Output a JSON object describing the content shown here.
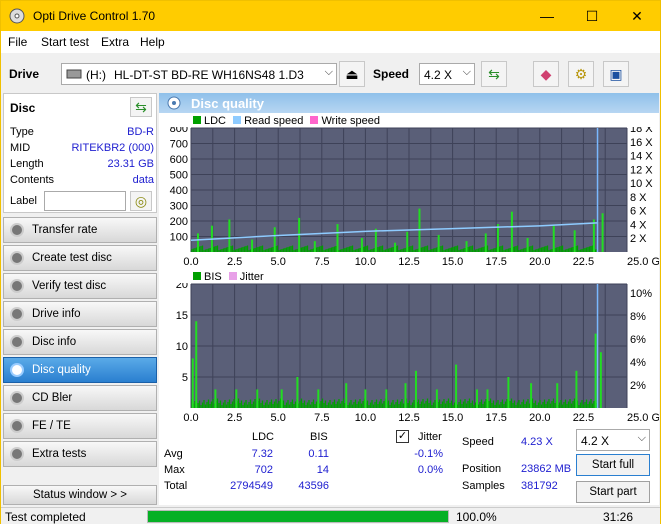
{
  "window": {
    "title": "Opti Drive Control 1.70",
    "min": "—",
    "max": "☐",
    "close": "✕"
  },
  "menu": [
    "File",
    "Start test",
    "Extra",
    "Help"
  ],
  "drivebar": {
    "drive_label": "Drive",
    "drive_letter": "(H:)",
    "drive_name": "HL-DT-ST BD-RE  WH16NS48 1.D3",
    "speed_label": "Speed",
    "speed_value": "4.2 X"
  },
  "disc": {
    "header": "Disc",
    "rows": [
      {
        "k": "Type",
        "v": "BD-R"
      },
      {
        "k": "MID",
        "v": "RITEKBR2 (000)"
      },
      {
        "k": "Length",
        "v": "23.31 GB"
      },
      {
        "k": "Contents",
        "v": "data"
      }
    ],
    "label_key": "Label",
    "label_value": ""
  },
  "nav": [
    "Transfer rate",
    "Create test disc",
    "Verify test disc",
    "Drive info",
    "Disc info",
    "Disc quality",
    "CD Bler",
    "FE / TE",
    "Extra tests"
  ],
  "nav_selected": 5,
  "status_window_btn": "Status window > >",
  "panel_title": "Disc quality",
  "legend_top": {
    "ldc": "LDC",
    "read": "Read speed",
    "write": "Write speed"
  },
  "legend_bottom": {
    "bis": "BIS",
    "jitter": "Jitter"
  },
  "colors": {
    "ldc": "#00a000",
    "read": "#8ecbff",
    "write": "#ff66cc",
    "bis": "#00a000",
    "jitter": "#e8a0e8",
    "plot_bg": "#5a5f78",
    "grid": "#3e4258",
    "accent": "#ffcc00"
  },
  "chart_data": [
    {
      "type": "bar",
      "name": "LDC / speed",
      "x_ticks": [
        "0.0",
        "2.5",
        "5.0",
        "7.5",
        "10.0",
        "12.5",
        "15.0",
        "17.5",
        "20.0",
        "22.5",
        "25.0 GB"
      ],
      "y_left_ticks": [
        "800",
        "700",
        "600",
        "500",
        "400",
        "300",
        "200",
        "100"
      ],
      "y_right_ticks": [
        "18 X",
        "16 X",
        "14 X",
        "12 X",
        "10 X",
        "8 X",
        "6 X",
        "4 X",
        "2 X"
      ],
      "xlim": [
        0,
        25
      ],
      "ylim": [
        0,
        800
      ],
      "y2lim": [
        0,
        18
      ],
      "ldc_spikes": [
        [
          0.4,
          120
        ],
        [
          1.2,
          170
        ],
        [
          2.2,
          210
        ],
        [
          3.5,
          80
        ],
        [
          4.8,
          160
        ],
        [
          6.2,
          220
        ],
        [
          7.1,
          70
        ],
        [
          8.4,
          180
        ],
        [
          9.8,
          90
        ],
        [
          10.6,
          150
        ],
        [
          11.7,
          60
        ],
        [
          12.4,
          130
        ],
        [
          13.1,
          280
        ],
        [
          14.2,
          110
        ],
        [
          15.8,
          70
        ],
        [
          16.9,
          120
        ],
        [
          17.6,
          180
        ],
        [
          18.4,
          260
        ],
        [
          19.3,
          90
        ],
        [
          20.8,
          170
        ],
        [
          22.0,
          140
        ],
        [
          23.1,
          210
        ],
        [
          23.6,
          250
        ]
      ],
      "read_speed": [
        [
          0,
          1.7
        ],
        [
          5,
          2.4
        ],
        [
          10,
          3.0
        ],
        [
          15,
          3.4
        ],
        [
          20,
          3.8
        ],
        [
          23.3,
          4.23
        ]
      ],
      "disc_end_gb": 23.31
    },
    {
      "type": "bar",
      "name": "BIS / jitter",
      "x_ticks": [
        "0.0",
        "2.5",
        "5.0",
        "7.5",
        "10.0",
        "12.5",
        "15.0",
        "17.5",
        "20.0",
        "22.5",
        "25.0 GB"
      ],
      "y_left_ticks": [
        "20",
        "15",
        "10",
        "5"
      ],
      "y_right_ticks": [
        "10%",
        "8%",
        "6%",
        "4%",
        "2%"
      ],
      "xlim": [
        0,
        25
      ],
      "ylim": [
        0,
        20
      ],
      "bis_spikes": [
        [
          0.1,
          8
        ],
        [
          0.3,
          14
        ],
        [
          1.4,
          3
        ],
        [
          2.6,
          3
        ],
        [
          3.8,
          3
        ],
        [
          5.2,
          3
        ],
        [
          6.1,
          5
        ],
        [
          7.3,
          3
        ],
        [
          8.9,
          4
        ],
        [
          10.0,
          3
        ],
        [
          11.2,
          3
        ],
        [
          12.3,
          4
        ],
        [
          12.9,
          6
        ],
        [
          14.1,
          3
        ],
        [
          15.2,
          7
        ],
        [
          16.4,
          3
        ],
        [
          17.0,
          3
        ],
        [
          18.2,
          5
        ],
        [
          19.5,
          4
        ],
        [
          21.0,
          4
        ],
        [
          22.1,
          6
        ],
        [
          23.2,
          12
        ],
        [
          23.5,
          9
        ]
      ]
    }
  ],
  "stats": {
    "ldc_h": "LDC",
    "bis_h": "BIS",
    "jitter_h": "Jitter",
    "avg_k": "Avg",
    "max_k": "Max",
    "total_k": "Total",
    "ldc_avg": "7.32",
    "ldc_max": "702",
    "ldc_total": "2794549",
    "bis_avg": "0.11",
    "bis_max": "14",
    "bis_total": "43596",
    "jit_avg": "-0.1%",
    "jit_max": "0.0%",
    "speed_k": "Speed",
    "speed_v": "4.23 X",
    "pos_k": "Position",
    "pos_v": "23862 MB",
    "samp_k": "Samples",
    "samp_v": "381792",
    "speed_select": "4.2 X",
    "start_full": "Start full",
    "start_part": "Start part"
  },
  "status": {
    "text": "Test completed",
    "progress": 1.0,
    "progress_label": "100.0%",
    "time": "31:26"
  }
}
